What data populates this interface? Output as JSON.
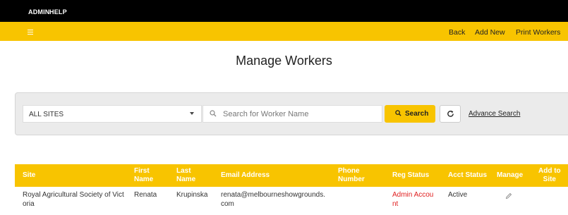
{
  "top_menu": {
    "admin": "ADMIN",
    "help": "HELP"
  },
  "nav": {
    "back": "Back",
    "add_new": "Add New",
    "print_workers": "Print Workers"
  },
  "page_title": "Manage Workers",
  "filters": {
    "site_select_value": "ALL SITES",
    "search_placeholder": "Search for Worker Name",
    "search_button": "Search",
    "advance_search": "Advance Search"
  },
  "table": {
    "headers": {
      "site": "Site",
      "first_name_1": "First",
      "first_name_2": "Name",
      "last_name_1": "Last",
      "last_name_2": "Name",
      "email": "Email Address",
      "phone_1": "Phone",
      "phone_2": "Number",
      "reg_status": "Reg Status",
      "acct_status": "Acct Status",
      "manage": "Manage",
      "add_to_site_1": "Add to",
      "add_to_site_2": "Site"
    },
    "rows": [
      {
        "site_1": "Royal Agricultural Society of Vict",
        "site_2": "oria",
        "first_name": "Renata",
        "last_name": "Krupinska",
        "email_1": "renata@melbourneshowgrounds.",
        "email_2": "com",
        "reg_status_1": "Admin Accou",
        "reg_status_2": "nt",
        "acct_status": "Active"
      }
    ]
  },
  "colors": {
    "brand_yellow": "#f8c400",
    "top_bar": "#000000",
    "reg_status_red": "#e02020"
  }
}
